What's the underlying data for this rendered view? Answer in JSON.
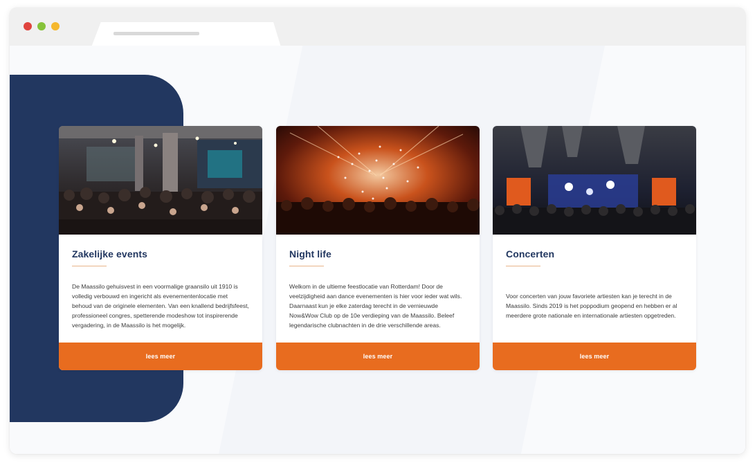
{
  "browser": {
    "controls": [
      "close-dot",
      "minimize-dot",
      "maximize-dot"
    ],
    "colors": {
      "close": "#e0443e",
      "minimize": "#86c33a",
      "maximize": "#f5b82e"
    }
  },
  "theme": {
    "navy": "#223760",
    "accent_orange": "#e86c1f"
  },
  "cards": [
    {
      "title": "Zakelijke events",
      "image": "crowd-event-hall-photo",
      "text": "De Maassilo gehuisvest in een voormalige graansilo uit 1910 is volledig verbouwd en ingericht als evenementenlocatie met behoud van de originele elementen. Van een knallend bedrijfsfeest, professioneel congres, spetterende modeshow tot inspirerende vergadering, in de Maassilo is het mogelijk.",
      "button": "lees meer"
    },
    {
      "title": "Night life",
      "image": "confetti-party-photo",
      "text": "Welkom in de ultieme feestlocatie van Rotterdam! Door de veelzijdigheid aan dance evenementen is hier voor ieder wat wils. Daarnaast kun je elke zaterdag terecht in de vernieuwde Now&Wow Club op de 10e verdieping van de Maassilo. Beleef legendarische clubnachten in de drie verschillende areas.",
      "button": "lees meer"
    },
    {
      "title": "Concerten",
      "image": "concert-stage-photo",
      "text": "Voor concerten van jouw favoriete artiesten kan je terecht in de Maassilo. Sinds 2019 is het poppodium geopend en hebben er al meerdere grote nationale en internationale artiesten opgetreden.",
      "button": "lees meer"
    }
  ]
}
